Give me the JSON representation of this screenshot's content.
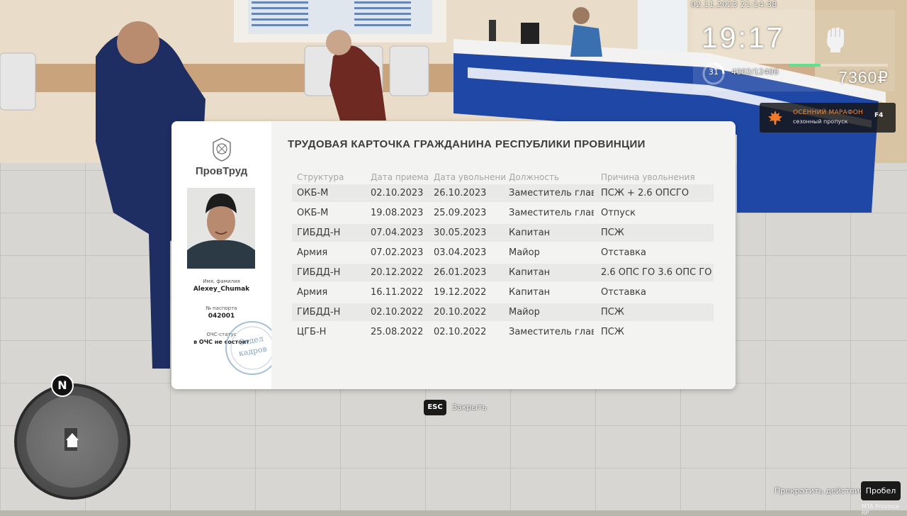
{
  "hud": {
    "datetime": "02.11.2023 21:14:38",
    "clock": "19:17",
    "level": "31",
    "xp": "4002/12400",
    "xp_progress": 0.32,
    "money": "7360₽",
    "fist_icon": "fist-icon",
    "colors": {
      "xp_bar": "#5fe08a",
      "marathon_title": "#f08a3a"
    }
  },
  "marathon": {
    "title": "ОСЕННИЙ МАРАФОН",
    "subtitle": "сезонный пропуск",
    "key": "F4",
    "icon": "maple-leaf-icon"
  },
  "card": {
    "org": "ПровТруд",
    "title": "ТРУДОВАЯ КАРТОЧКА ГРАЖДАНИНА РЕСПУБЛИКИ ПРОВИНЦИИ",
    "name_label": "Имя, фамилия",
    "name_value": "Alexey_Chumak",
    "passport_label": "№ паспорта",
    "passport_value": "042001",
    "ochs_label": "ОЧС-статус",
    "ochs_value": "в ОЧС не состоит",
    "stamp_text": "Отдел кадров",
    "columns": [
      "Структура",
      "Дата приема",
      "Дата увольнения",
      "Должность",
      "Причина увольнения"
    ],
    "rows": [
      [
        "ОКБ-М",
        "02.10.2023",
        "26.10.2023",
        "Заместитель главног",
        "ПСЖ + 2.6 ОПСГО"
      ],
      [
        "ОКБ-М",
        "19.08.2023",
        "25.09.2023",
        "Заместитель главног",
        "Отпуск"
      ],
      [
        "ГИБДД-Н",
        "07.04.2023",
        "30.05.2023",
        "Капитан",
        "ПСЖ"
      ],
      [
        "Армия",
        "07.02.2023",
        "03.04.2023",
        "Майор",
        "Отставка"
      ],
      [
        "ГИБДД-Н",
        "20.12.2022",
        "26.01.2023",
        "Капитан",
        "2.6 ОПС ГО 3.6 ОПС ГО"
      ],
      [
        "Армия",
        "16.11.2022",
        "19.12.2022",
        "Капитан",
        "Отставка"
      ],
      [
        "ГИБДД-Н",
        "02.10.2022",
        "20.10.2022",
        "Майор",
        "ПСЖ"
      ],
      [
        "ЦГБ-Н",
        "25.08.2022",
        "02.10.2022",
        "Заместитель главног",
        "ПСЖ"
      ]
    ]
  },
  "controls": {
    "esc_key": "ESC",
    "esc_label": "Закрыть",
    "stop_label": "Прекратить действие",
    "space_key": "Пробел"
  },
  "minimap": {
    "north": "N"
  },
  "watermark": "MTA Province RP"
}
